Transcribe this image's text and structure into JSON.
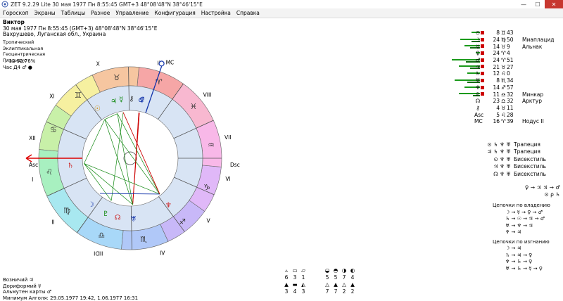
{
  "titlebar": {
    "title": "ZET 9.2.29 Lite   30 мая 1977  Пн   8:55:45 GMT+3 48°08'48\"N  38°46'15\"E",
    "minimize": "—",
    "maximize": "☐",
    "close": "✕"
  },
  "menu": [
    "Гороскоп",
    "Экраны",
    "Таблицы",
    "Разное",
    "Управление",
    "Конфигурация",
    "Настройка",
    "Справка"
  ],
  "info": {
    "name": "Виктор",
    "datetime": "30 мая 1977  Пн   8:55:45 (GMT+3) 48°08'48\"N  38°46'15\"E",
    "place": "Вахрушево, Луганская обл., Украина"
  },
  "modes": [
    "Тропический",
    "Эклиптикальная",
    "Геоцентрическая",
    "Плацидус"
  ],
  "moon_phase": "☽  12 92.76%",
  "hour_line": "Час Д4  ♂  ●",
  "chart": {
    "houses": [
      "I",
      "II",
      "III",
      "IV",
      "V",
      "VI",
      "VII",
      "VIII",
      "IX",
      "X",
      "XI",
      "XII"
    ],
    "asc_label": "Asc",
    "dsc_label": "Dsc",
    "mc_label": "MC",
    "ic_label": "IC",
    "signs": [
      {
        "glyph": "♈",
        "color": "#f6a6a6"
      },
      {
        "glyph": "♉",
        "color": "#f6c6a0"
      },
      {
        "glyph": "♊",
        "color": "#f6f0a0"
      },
      {
        "glyph": "♋",
        "color": "#c8f0a8"
      },
      {
        "glyph": "♌",
        "color": "#a8f0c0"
      },
      {
        "glyph": "♍",
        "color": "#a8e8f0"
      },
      {
        "glyph": "♎",
        "color": "#a8d8f8"
      },
      {
        "glyph": "♏",
        "color": "#b0c8f8"
      },
      {
        "glyph": "♐",
        "color": "#c8b8f8"
      },
      {
        "glyph": "♑",
        "color": "#e0b8f8"
      },
      {
        "glyph": "♒",
        "color": "#f8b8e8"
      },
      {
        "glyph": "♓",
        "color": "#f8b8d0"
      }
    ],
    "inner_planets": [
      "☊",
      "⚸",
      "♄",
      "♀",
      "♂",
      "☉",
      "♃",
      "⚷",
      "♆",
      "♅",
      "☽",
      "♇",
      "⊗",
      "⚶"
    ]
  },
  "planets": [
    {
      "sym": "⊙",
      "deg": "8",
      "sign": "♊",
      "min": "43",
      "label": "",
      "bars": [
        12,
        0
      ],
      "red": true
    },
    {
      "sym": "☽",
      "deg": "24",
      "sign": "♍",
      "min": "50",
      "label": "Миаплацид",
      "bars": [
        28,
        12
      ],
      "red": true
    },
    {
      "sym": "☿",
      "deg": "14",
      "sign": "♉",
      "min": "9",
      "label": "Альнак",
      "bars": [
        22,
        14
      ],
      "red": true
    },
    {
      "sym": "♀",
      "deg": "24",
      "sign": "♈",
      "min": "4",
      "label": "",
      "bars": [
        6,
        0
      ],
      "red": true
    },
    {
      "sym": "♂",
      "deg": "24",
      "sign": "♈",
      "min": "51",
      "label": "",
      "bars": [
        40,
        20
      ],
      "red": true
    },
    {
      "sym": "♃",
      "deg": "21",
      "sign": "♉",
      "min": "27",
      "label": "",
      "bars": [
        30,
        14
      ],
      "red": true
    },
    {
      "sym": "♄",
      "deg": "12",
      "sign": "♌",
      "min": "0",
      "label": "",
      "bars": [
        18,
        0
      ],
      "red": true
    },
    {
      "sym": "♅",
      "deg": "8",
      "sign": "♏",
      "min": "34",
      "label": "",
      "bars": [
        36,
        18
      ],
      "red": true
    },
    {
      "sym": "♆",
      "deg": "14",
      "sign": "♐",
      "min": "57",
      "label": "",
      "bars": [
        22,
        0
      ],
      "red": true
    },
    {
      "sym": "♇",
      "deg": "11",
      "sign": "♎",
      "min": "32",
      "label": "Минкар",
      "bars": [
        30,
        10
      ],
      "red": true
    },
    {
      "sym": "☊",
      "deg": "23",
      "sign": "♎",
      "min": "32",
      "label": "Арктур",
      "bars": [
        0,
        0
      ],
      "red": false
    },
    {
      "sym": "⚷",
      "deg": "4",
      "sign": "♉",
      "min": "11",
      "label": "",
      "bars": [
        0,
        0
      ],
      "red": false
    },
    {
      "sym": "Asc",
      "deg": "5",
      "sign": "♌",
      "min": "28",
      "label": "",
      "bars": [
        0,
        0
      ],
      "red": false
    },
    {
      "sym": "MC",
      "deg": "16",
      "sign": "♈",
      "min": "39",
      "label": "Нодус II",
      "bars": [
        0,
        0
      ],
      "red": false
    }
  ],
  "configurations": [
    {
      "glyphs": "⊙ ♄ ♆ ♅",
      "label": "Трапеция"
    },
    {
      "glyphs": "♃ ♄ ♆ ♅",
      "label": "Трапеция"
    },
    {
      "glyphs": "⊙ ♆ ♅",
      "label": "Бисекстиль"
    },
    {
      "glyphs": "♃ ♆ ♅",
      "label": "Бисекстиль"
    },
    {
      "glyphs": "☊ ♆ ♅",
      "label": "Бисекстиль"
    }
  ],
  "extra": {
    "line1": "♀ → ♃ ♃ → ♂",
    "line2": "⊙ ρ ♄"
  },
  "chains": {
    "title1": "Цепочки по владению",
    "rows1": [
      "☽ → ☿ → ♀ → ♂",
      "♄ → ☉ → ♃ → ♂",
      "♅ → ♆ → ♃",
      "♆ → ♃"
    ],
    "title2": "Цепочки по изгнанию",
    "rows2": [
      "☽ → ♃",
      "♄ → ♃ → ♀",
      "♆ → ♄ → ♀",
      "♅ → ♄ → ☿ → ♀"
    ]
  },
  "bottom": {
    "line1": "Возничий  ♃",
    "line2": "Дориформий  ☿",
    "line3": "Альмутен карты  ♂",
    "line4": "Минимум Алголя: 29.05.1977 19:42,  1.06.1977 16:31"
  },
  "elements": {
    "left": {
      "icons": [
        "▵",
        "▭",
        "▱"
      ],
      "values": [
        "6",
        "3",
        "1"
      ],
      "values2": [
        "3",
        "4",
        "3"
      ]
    },
    "right": {
      "icons": [
        "◒",
        "◓",
        "◑",
        "◐"
      ],
      "values": [
        "5",
        "5",
        "7",
        "4"
      ],
      "values2": [
        "7",
        "7",
        "2",
        "2"
      ]
    }
  }
}
